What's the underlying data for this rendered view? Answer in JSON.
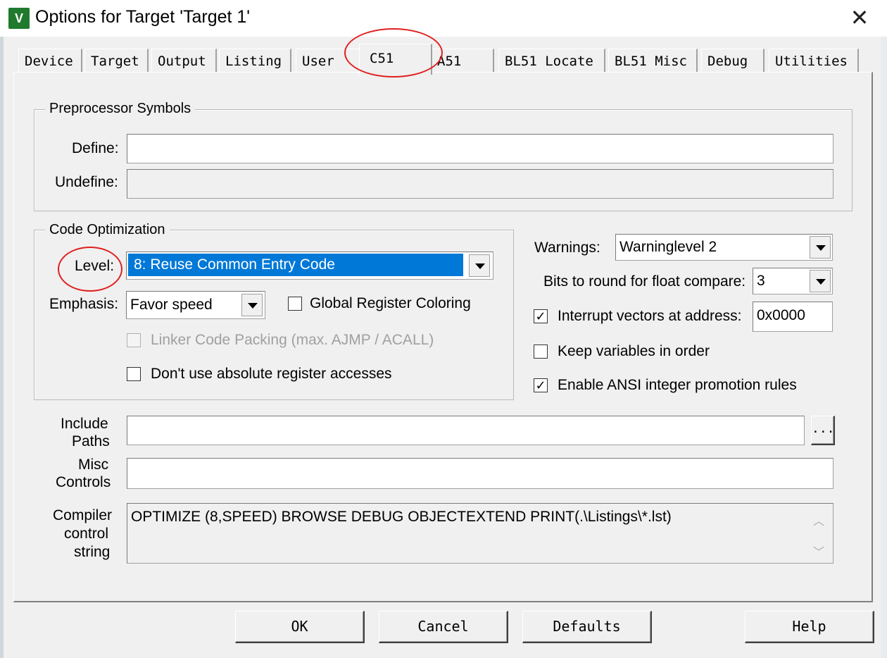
{
  "window": {
    "title": "Options for Target 'Target 1'",
    "app_icon": "uv-icon",
    "close_glyph": "✕"
  },
  "tabs": [
    {
      "label": "Device"
    },
    {
      "label": "Target"
    },
    {
      "label": "Output"
    },
    {
      "label": "Listing"
    },
    {
      "label": "User"
    },
    {
      "label": "C51",
      "active": true
    },
    {
      "label": "A51"
    },
    {
      "label": "BL51 Locate"
    },
    {
      "label": "BL51 Misc"
    },
    {
      "label": "Debug"
    },
    {
      "label": "Utilities"
    }
  ],
  "preprocessor": {
    "legend": "Preprocessor Symbols",
    "define_label": "Define:",
    "define_value": "",
    "undefine_label": "Undefine:",
    "undefine_value": ""
  },
  "code_optimization": {
    "legend": "Code Optimization",
    "level_label": "Level:",
    "level_value": "8: Reuse Common Entry Code",
    "emphasis_label": "Emphasis:",
    "emphasis_value": "Favor speed",
    "global_register_coloring": {
      "label": "Global Register Coloring",
      "checked": false
    },
    "linker_code_packing": {
      "label": "Linker Code Packing (max. AJMP / ACALL)",
      "checked": false,
      "disabled": true
    },
    "dont_use_absolute": {
      "label": "Don't use absolute register accesses",
      "checked": false
    }
  },
  "warnings": {
    "label": "Warnings:",
    "value": "Warninglevel 2"
  },
  "bits_round": {
    "label": "Bits to round for float compare:",
    "value": "3"
  },
  "interrupt_vectors": {
    "label": "Interrupt vectors at address:",
    "checked": true,
    "value": "0x0000"
  },
  "keep_variables": {
    "label": "Keep variables in order",
    "checked": false
  },
  "ansi_promotion": {
    "label": "Enable ANSI integer promotion rules",
    "checked": true
  },
  "include_paths": {
    "label_line1": "Include",
    "label_line2": "Paths",
    "value": "",
    "browse_label": "..."
  },
  "misc_controls": {
    "label_line1": "Misc",
    "label_line2": "Controls",
    "value": ""
  },
  "compiler_string": {
    "label_line1": "Compiler",
    "label_line2": "control",
    "label_line3": "string",
    "value": "OPTIMIZE (8,SPEED) BROWSE DEBUG OBJECTEXTEND PRINT(.\\Listings\\*.lst)"
  },
  "buttons": {
    "ok": "OK",
    "cancel": "Cancel",
    "defaults": "Defaults",
    "help": "Help"
  },
  "colors": {
    "selection": "#0078d7",
    "annotation_circle": "#e02020",
    "dialog_bg": "#f0f0f0"
  }
}
